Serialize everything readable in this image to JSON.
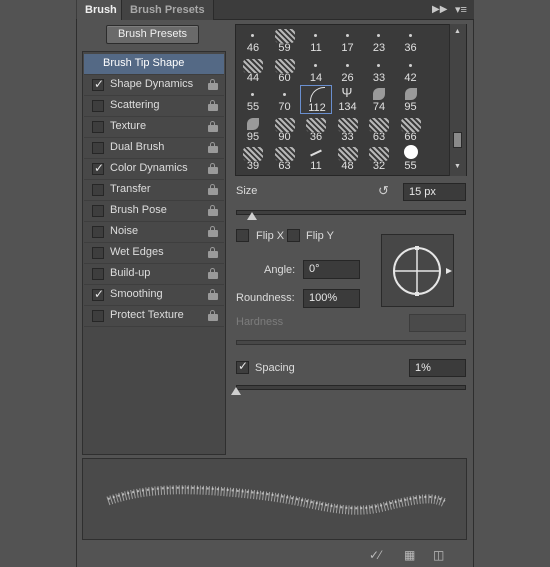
{
  "tabs": {
    "brush": "Brush",
    "brush_presets": "Brush Presets"
  },
  "brush_presets_button": "Brush Presets",
  "options": [
    {
      "label": "Brush Tip Shape",
      "checked": null,
      "selected": true,
      "lock": false
    },
    {
      "label": "Shape Dynamics",
      "checked": true,
      "selected": false,
      "lock": true
    },
    {
      "label": "Scattering",
      "checked": false,
      "selected": false,
      "lock": true
    },
    {
      "label": "Texture",
      "checked": false,
      "selected": false,
      "lock": true
    },
    {
      "label": "Dual Brush",
      "checked": false,
      "selected": false,
      "lock": true
    },
    {
      "label": "Color Dynamics",
      "checked": true,
      "selected": false,
      "lock": true
    },
    {
      "label": "Transfer",
      "checked": false,
      "selected": false,
      "lock": true
    },
    {
      "label": "Brush Pose",
      "checked": false,
      "selected": false,
      "lock": true
    },
    {
      "label": "Noise",
      "checked": false,
      "selected": false,
      "lock": true
    },
    {
      "label": "Wet Edges",
      "checked": false,
      "selected": false,
      "lock": true
    },
    {
      "label": "Build-up",
      "checked": false,
      "selected": false,
      "lock": true
    },
    {
      "label": "Smoothing",
      "checked": true,
      "selected": false,
      "lock": true
    },
    {
      "label": "Protect Texture",
      "checked": false,
      "selected": false,
      "lock": true
    }
  ],
  "brush_grid": [
    [
      "46",
      "59",
      "11",
      "17",
      "23",
      "36"
    ],
    [
      "44",
      "60",
      "14",
      "26",
      "33",
      "42"
    ],
    [
      "55",
      "70",
      "112",
      "134",
      "74",
      "95"
    ],
    [
      "95",
      "90",
      "36",
      "33",
      "63",
      "66"
    ],
    [
      "39",
      "63",
      "11",
      "48",
      "32",
      "55"
    ]
  ],
  "brush_grid_selected": "112",
  "size": {
    "label": "Size",
    "value": "15 px"
  },
  "flip_x": {
    "label": "Flip X",
    "checked": false
  },
  "flip_y": {
    "label": "Flip Y",
    "checked": false
  },
  "angle": {
    "label": "Angle:",
    "value": "0°"
  },
  "roundness": {
    "label": "Roundness:",
    "value": "100%"
  },
  "hardness": {
    "label": "Hardness",
    "value": ""
  },
  "spacing": {
    "label": "Spacing",
    "checked": true,
    "value": "1%"
  },
  "colors": {
    "panel": "#535353",
    "selected_row": "#546985",
    "accent": "#6a8fcf"
  }
}
